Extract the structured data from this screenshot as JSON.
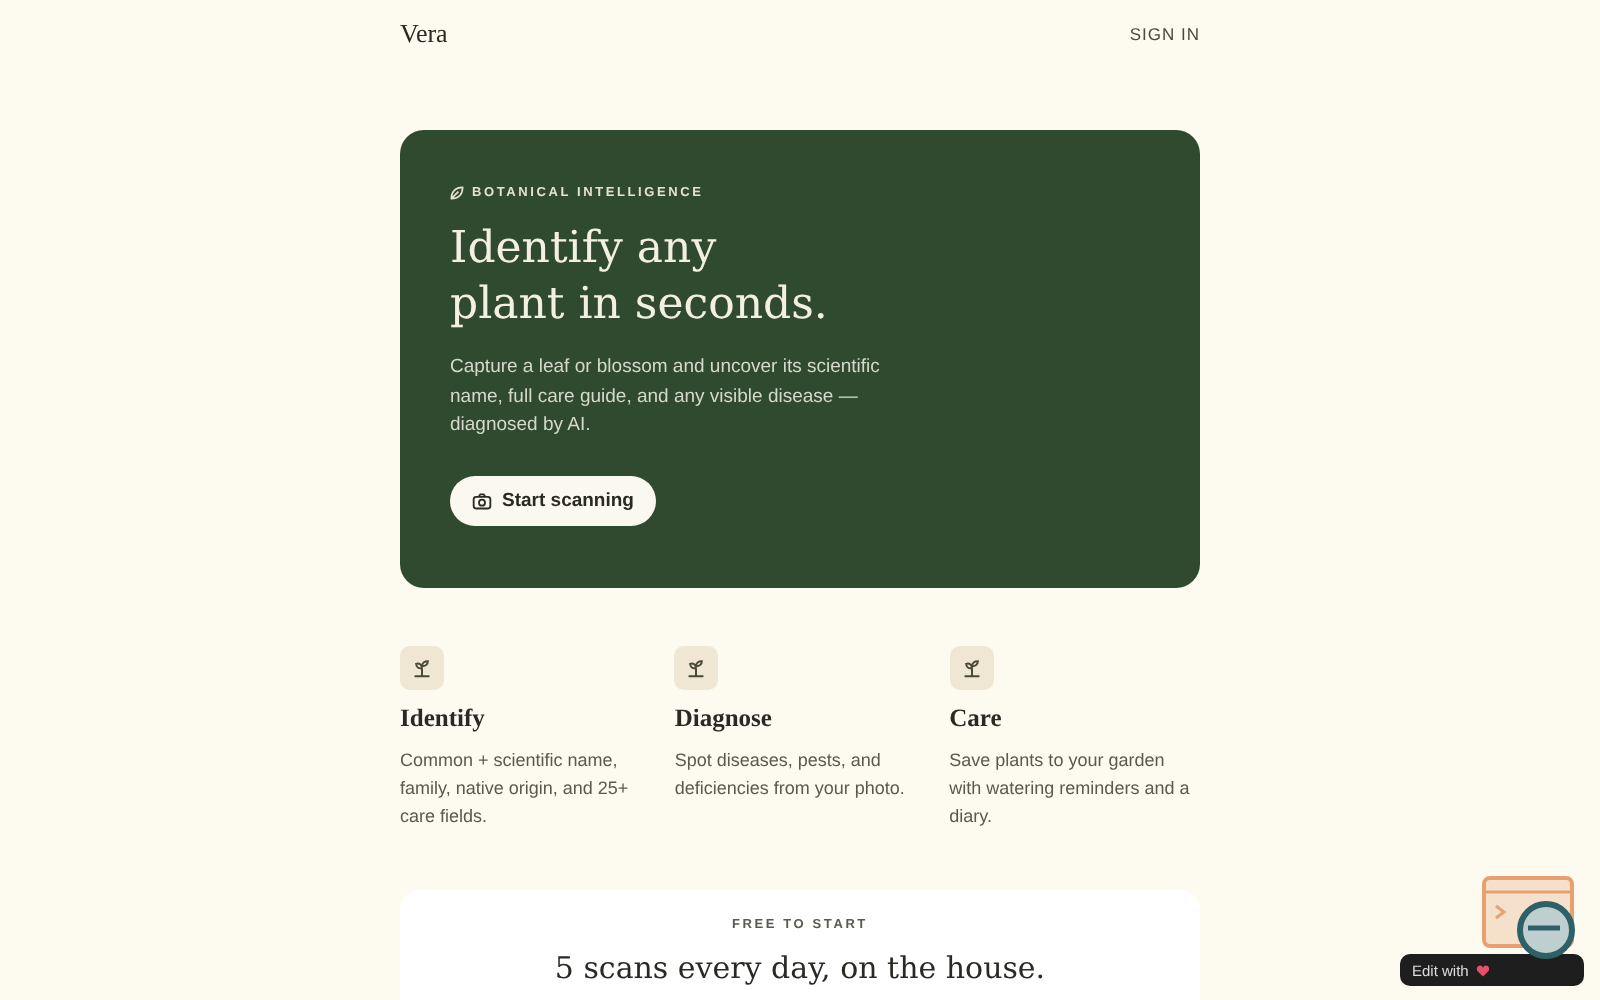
{
  "header": {
    "brand": "Vera",
    "sign_in": "SIGN IN"
  },
  "hero": {
    "eyebrow": "BOTANICAL INTELLIGENCE",
    "title_lines": [
      "Identify any",
      "plant in seconds."
    ],
    "description": "Capture a leaf or blossom and uncover its scientific name, full care guide, and any visible disease — diagnosed by AI.",
    "button": "Start scanning"
  },
  "features": [
    {
      "title": "Identify",
      "text": "Common + scientific name, family, native origin, and 25+ care fields."
    },
    {
      "title": "Diagnose",
      "text": "Spot diseases, pests, and deficiencies from your photo."
    },
    {
      "title": "Care",
      "text": "Save plants to your garden with watering reminders and a diary."
    }
  ],
  "pricing": {
    "eyebrow": "FREE TO START",
    "headline": "5 scans every day, on the house."
  },
  "badge": {
    "label": "Edit with"
  }
}
